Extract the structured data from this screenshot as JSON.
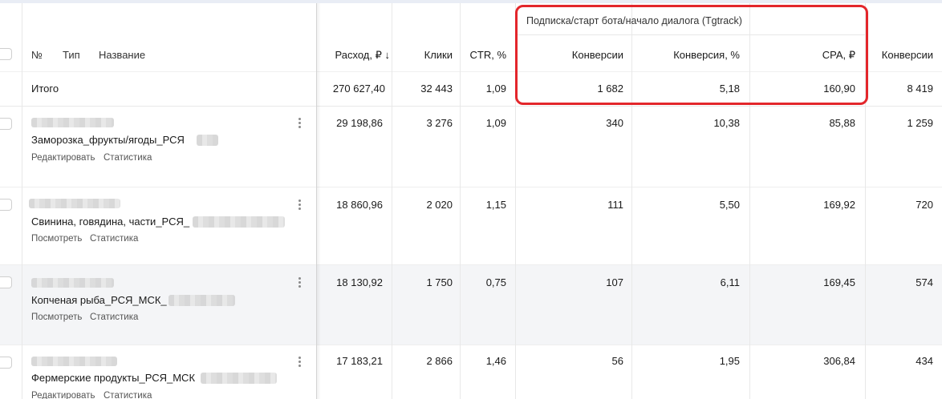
{
  "header": {
    "group_title": "Подписка/старт бота/начало диалога (Tgtrack)",
    "col_num": "№",
    "col_type": "Тип",
    "col_name": "Название",
    "col_spend": "Расход, ₽ ↓",
    "col_clicks": "Клики",
    "col_ctr": "CTR, %",
    "col_conv": "Конверсии",
    "col_conv_rate": "Конверсия, %",
    "col_cpa": "CPA, ₽",
    "col_conv_next": "Конверсии"
  },
  "totals": {
    "label": "Итого",
    "spend": "270 627,40",
    "clicks": "32 443",
    "ctr": "1,09",
    "conv": "1 682",
    "conv_rate": "5,18",
    "cpa": "160,90",
    "conv_next": "8 419"
  },
  "rows": [
    {
      "name": "Заморозка_фрукты/ягоды_РСЯ",
      "action1": "Редактировать",
      "action2": "Статистика",
      "spend": "29 198,86",
      "clicks": "3 276",
      "ctr": "1,09",
      "conv": "340",
      "conv_rate": "10,38",
      "cpa": "85,88",
      "conv_next": "1 259"
    },
    {
      "name": "Свинина, говядина, части_РСЯ_",
      "action1": "Посмотреть",
      "action2": "Статистика",
      "spend": "18 860,96",
      "clicks": "2 020",
      "ctr": "1,15",
      "conv": "111",
      "conv_rate": "5,50",
      "cpa": "169,92",
      "conv_next": "720"
    },
    {
      "name": "Копченая рыба_РСЯ_МСК_",
      "action1": "Посмотреть",
      "action2": "Статистика",
      "spend": "18 130,92",
      "clicks": "1 750",
      "ctr": "0,75",
      "conv": "107",
      "conv_rate": "6,11",
      "cpa": "169,45",
      "conv_next": "574"
    },
    {
      "name": "Фермерские продукты_РСЯ_МСК",
      "action1": "Редактировать",
      "action2": "Статистика",
      "spend": "17 183,21",
      "clicks": "2 866",
      "ctr": "1,46",
      "conv": "56",
      "conv_rate": "1,95",
      "cpa": "306,84",
      "conv_next": "434"
    }
  ]
}
